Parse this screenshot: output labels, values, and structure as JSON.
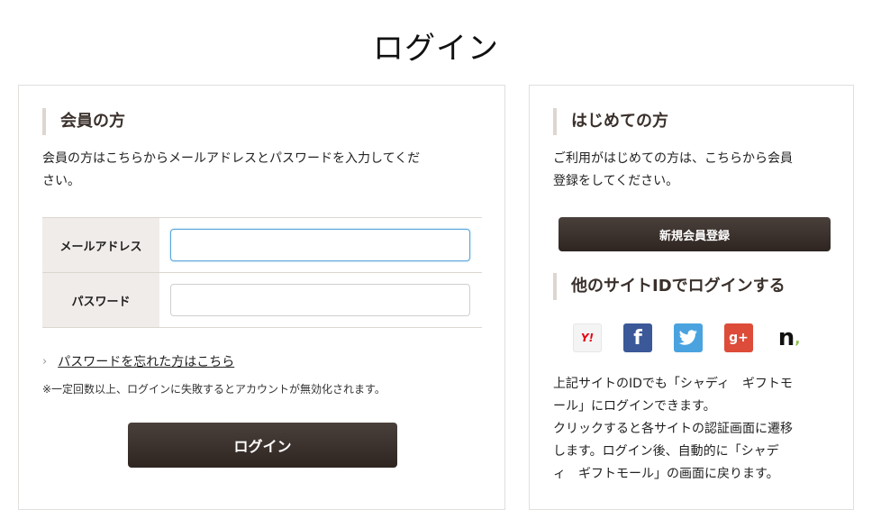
{
  "page": {
    "title": "ログイン"
  },
  "member": {
    "heading": "会員の方",
    "description_line1": "会員の方はこちらからメールアドレスとパスワードを入力してくだ",
    "description_line2": "さい。",
    "email_label": "メールアドレス",
    "email_value": "",
    "password_label": "パスワード",
    "password_value": "",
    "forgot_chevron": "›",
    "forgot_link": "パスワードを忘れた方はこちら",
    "notice": "※一定回数以上、ログインに失敗するとアカウントが無効化されます。",
    "login_button": "ログイン"
  },
  "new_user": {
    "heading": "はじめての方",
    "description_line1": "ご利用がはじめての方は、こちらから会員",
    "description_line2": "登録をしてください。",
    "register_button": "新規会員登録"
  },
  "social": {
    "heading": "他のサイトIDでログインする",
    "icons": [
      {
        "name": "yahoo-icon",
        "glyph": "Y!"
      },
      {
        "name": "facebook-icon",
        "glyph": "f"
      },
      {
        "name": "twitter-icon",
        "glyph": "🐦"
      },
      {
        "name": "google-plus-icon",
        "glyph": "g+"
      },
      {
        "name": "n-icon",
        "glyph": "n"
      }
    ],
    "description_line1": "上記サイトのIDでも「シャディ　ギフトモ",
    "description_line2": "ール」にログインできます。",
    "description_line3": "クリックすると各サイトの認証画面に遷移",
    "description_line4": "します。ログイン後、自動的に「シャデ",
    "description_line5": "ィ　ギフトモール」の画面に戻ります。"
  },
  "colors": {
    "button_dark": "#3a302b",
    "heading_bar": "#ddd6d0",
    "label_bg": "#f0ecea",
    "focus_border": "#5aa6d8"
  }
}
